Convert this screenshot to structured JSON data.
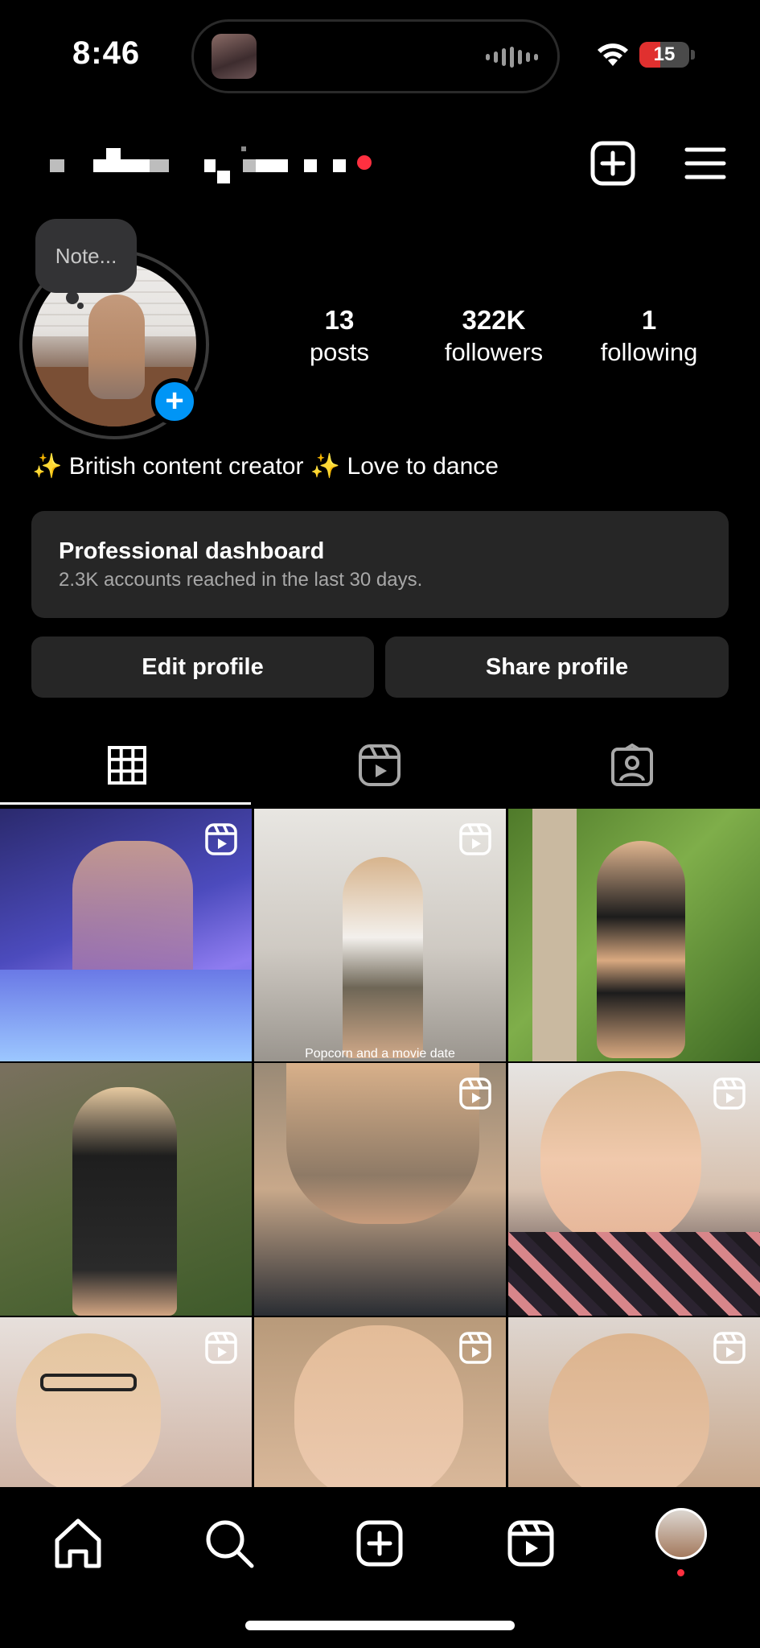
{
  "status_bar": {
    "time": "8:46",
    "battery_level": "15",
    "battery_color": "#e0302f"
  },
  "header": {
    "username": "",
    "create_icon": "plus-square-icon",
    "menu_icon": "hamburger-menu-icon"
  },
  "profile": {
    "note_placeholder": "Note...",
    "stats": [
      {
        "value": "13",
        "label": "posts"
      },
      {
        "value": "322K",
        "label": "followers"
      },
      {
        "value": "1",
        "label": "following"
      }
    ],
    "bio": "✨ British content creator ✨ Love to dance"
  },
  "dashboard": {
    "title": "Professional dashboard",
    "subtitle": "2.3K accounts reached in the last 30 days."
  },
  "actions": {
    "edit_label": "Edit profile",
    "share_label": "Share profile"
  },
  "tabs": [
    {
      "icon": "grid-icon",
      "selected": true
    },
    {
      "icon": "reels-icon",
      "selected": false
    },
    {
      "icon": "tagged-icon",
      "selected": false
    }
  ],
  "posts": [
    {
      "type": "reel",
      "caption": ""
    },
    {
      "type": "reel",
      "caption": "Popcorn and a movie date"
    },
    {
      "type": "photo",
      "caption": ""
    },
    {
      "type": "photo",
      "caption": ""
    },
    {
      "type": "reel",
      "caption": ""
    },
    {
      "type": "reel",
      "caption": ""
    },
    {
      "type": "reel",
      "caption": ""
    },
    {
      "type": "reel",
      "caption": ""
    },
    {
      "type": "reel",
      "caption": ""
    }
  ],
  "bottom_nav": [
    {
      "icon": "home-icon"
    },
    {
      "icon": "search-icon"
    },
    {
      "icon": "create-icon"
    },
    {
      "icon": "reels-icon"
    },
    {
      "icon": "profile-avatar"
    }
  ],
  "colors": {
    "background": "#000000",
    "surface": "#262626",
    "accent_blue": "#0095f6",
    "notification_red": "#ff3040"
  }
}
